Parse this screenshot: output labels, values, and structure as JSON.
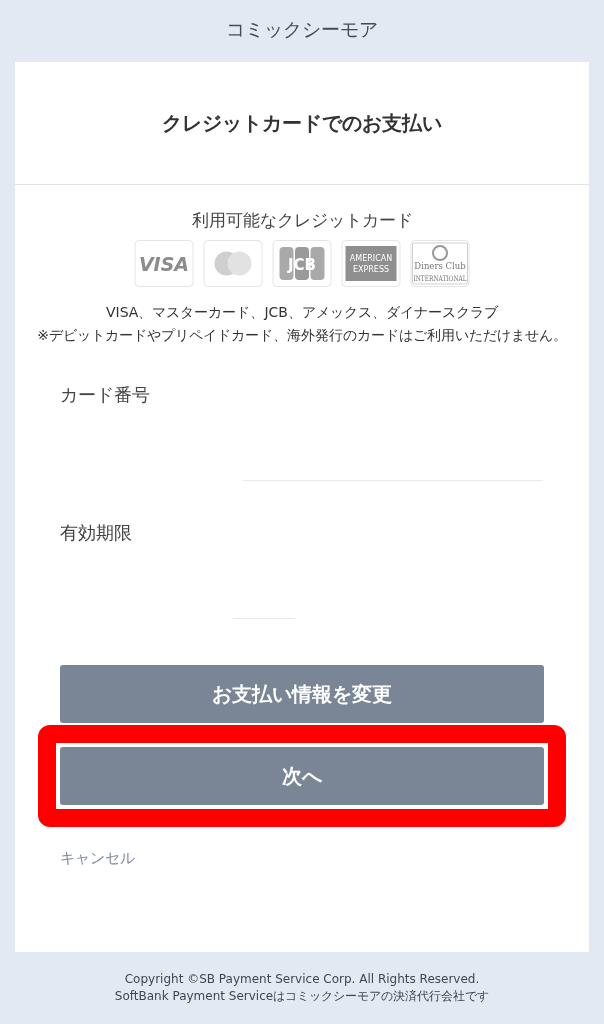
{
  "header": {
    "title": "コミックシーモア"
  },
  "panel": {
    "title": "クレジットカードでのお支払い"
  },
  "accepted_cards": {
    "heading": "利用可能なクレジットカード",
    "logos": [
      {
        "kind": "visa",
        "label": "VISA"
      },
      {
        "kind": "mastercard"
      },
      {
        "kind": "jcb",
        "label": "JCB"
      },
      {
        "kind": "amex",
        "label": "AMERICAN",
        "sublabel": "EXPRESS"
      },
      {
        "kind": "diners",
        "label": "Diners Club",
        "sublabel": "INTERNATIONAL"
      }
    ],
    "card_list": "VISA、マスターカード、JCB、アメックス、ダイナースクラブ",
    "note": "※デビットカードやプリペイドカード、海外発行のカードはご利用いただけません。"
  },
  "fields": [
    {
      "kind": "card_number",
      "label": "カード番号"
    },
    {
      "kind": "expiry",
      "label": "有効期限"
    }
  ],
  "buttons": [
    {
      "label": "お支払い情報を変更",
      "highlighted": false
    },
    {
      "label": "次へ",
      "highlighted": true
    }
  ],
  "cancel_link": "キャンセル",
  "footer": [
    "Copyright ©SB Payment Service Corp. All Rights Reserved.",
    "SoftBank Payment Serviceはコミックシーモアの決済代行会社です"
  ]
}
